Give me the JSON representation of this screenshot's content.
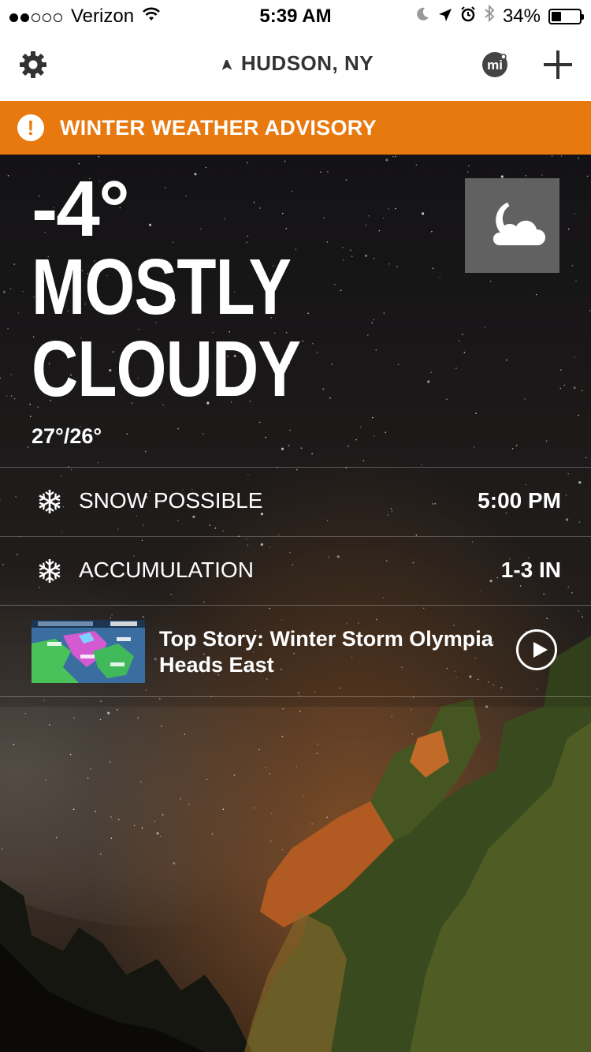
{
  "status_bar": {
    "carrier": "Verizon",
    "signal_bars_filled": 2,
    "signal_bars_total": 5,
    "time": "5:39 AM",
    "battery_percent": "34%",
    "battery_level": 0.34,
    "icons": [
      "wifi-icon",
      "moon-icon",
      "location-arrow-icon",
      "alarm-icon",
      "bluetooth-icon",
      "battery-icon"
    ]
  },
  "nav": {
    "location": "HUDSON, NY",
    "icons": [
      "gear-icon",
      "location-arrow-icon",
      "mi-logo-icon",
      "plus-icon"
    ]
  },
  "advisory": {
    "icon": "exclamation-icon",
    "text": "WINTER WEATHER ADVISORY",
    "color": "#e8790f"
  },
  "current": {
    "temperature": "-4°",
    "condition_line1": "MOSTLY",
    "condition_line2": "CLOUDY",
    "hi_lo": "27°/26°",
    "icon": "moon-cloud-icon"
  },
  "details": [
    {
      "icon": "snowflake-icon",
      "label": "SNOW POSSIBLE",
      "value": "5:00 PM"
    },
    {
      "icon": "snowflake-icon",
      "label": "ACCUMULATION",
      "value": "1-3 IN"
    }
  ],
  "story": {
    "title": "Top Story: Winter Storm Olympia Heads East",
    "icon": "play-icon"
  }
}
